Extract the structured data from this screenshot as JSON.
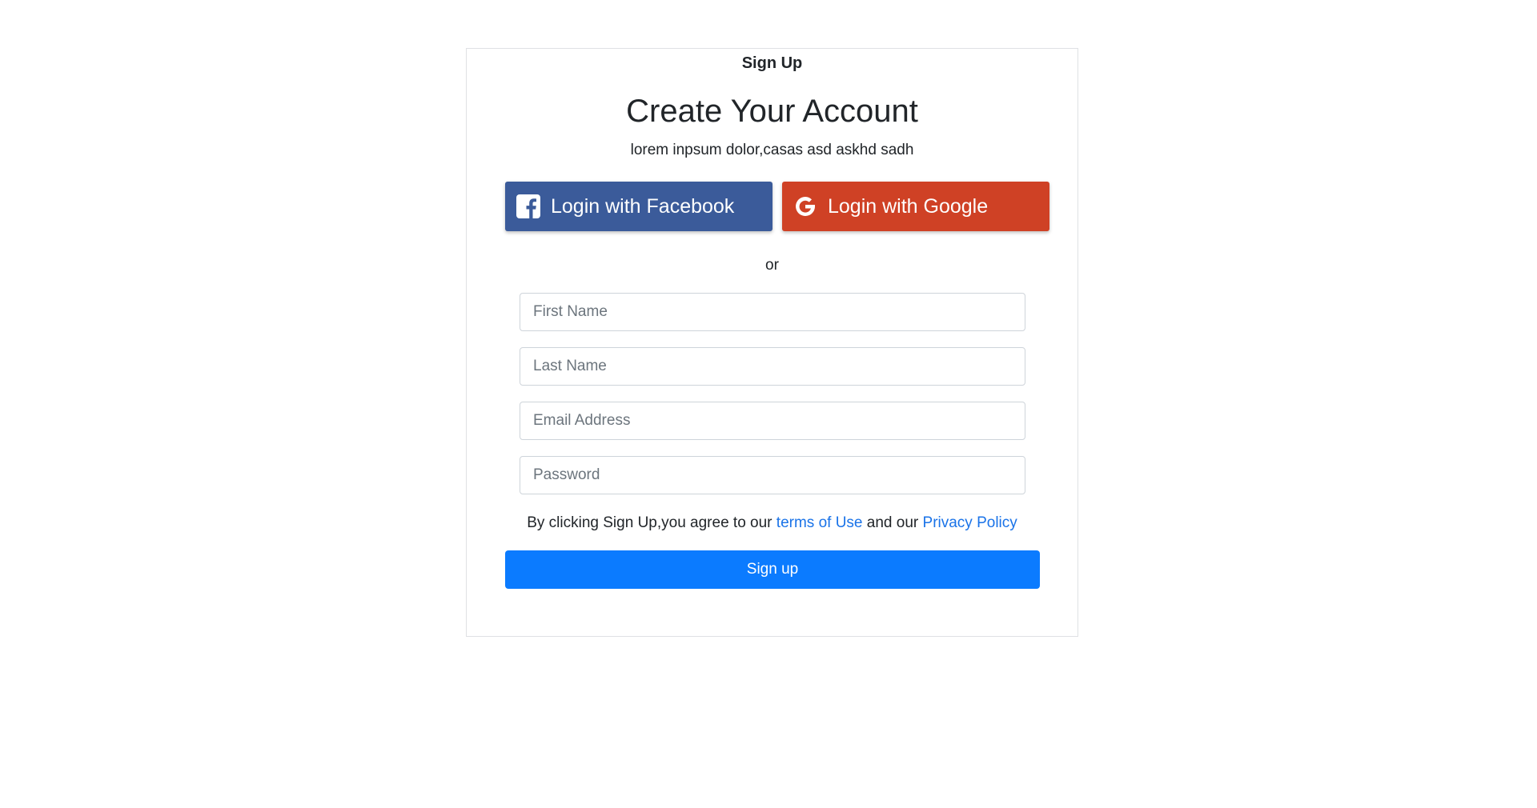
{
  "card": {
    "header": "Sign Up",
    "title": "Create Your Account",
    "subtitle": "lorem inpsum dolor,casas asd askhd sadh"
  },
  "social": {
    "facebook": {
      "label": "Login with Facebook",
      "icon": "facebook-icon",
      "color": "#3b5b9a"
    },
    "google": {
      "label": "Login with Google",
      "icon": "google-icon",
      "color": "#cf4125"
    }
  },
  "separator": "or",
  "form": {
    "first_name": {
      "placeholder": "First Name",
      "value": ""
    },
    "last_name": {
      "placeholder": "Last Name",
      "value": ""
    },
    "email": {
      "placeholder": "Email Address",
      "value": ""
    },
    "password": {
      "placeholder": "Password",
      "value": ""
    }
  },
  "terms": {
    "prefix": "By clicking Sign Up,you agree to our",
    "terms_link": "terms of Use",
    "middle": "and our",
    "privacy_link": "Privacy Policy"
  },
  "submit_label": "Sign up",
  "colors": {
    "primary": "#0b7bff",
    "link": "#1a73e8"
  }
}
